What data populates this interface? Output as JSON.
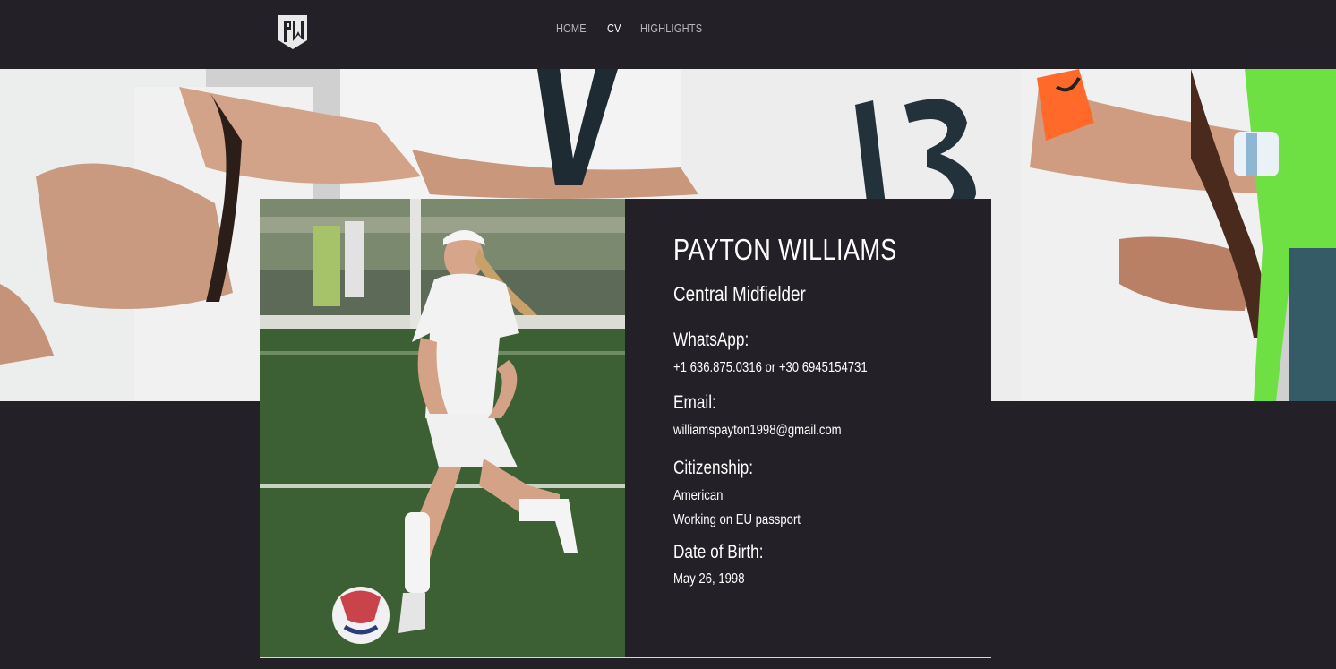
{
  "header": {
    "logo": "pw-monogram-logo",
    "nav": [
      {
        "label": "HOME",
        "active": false
      },
      {
        "label": "CV",
        "active": true
      },
      {
        "label": "HIGHLIGHTS",
        "active": false
      }
    ]
  },
  "profile": {
    "name": "PAYTON WILLIAMS",
    "position": "Central Midfielder",
    "whatsapp_label": "WhatsApp:",
    "whatsapp_value": "+1 636.875.0316 or +30 6945154731",
    "email_label": "Email:",
    "email_value": "williamspayton1998@gmail.com",
    "citizenship_label": "Citizenship:",
    "citizenship_line1": "American",
    "citizenship_line2": "Working on EU passport",
    "dob_label": "Date of Birth:",
    "dob_value": "May 26, 1998"
  },
  "colors": {
    "background": "#232027",
    "text": "#ffffff",
    "nav_inactive": "#b9b7bd"
  }
}
